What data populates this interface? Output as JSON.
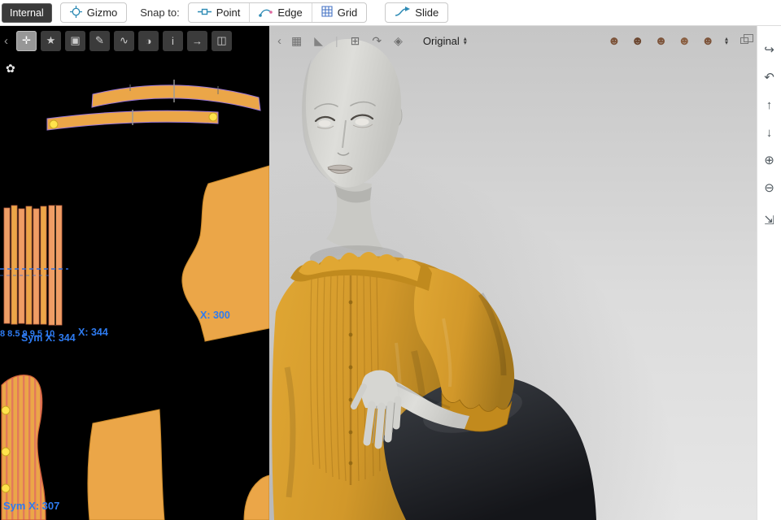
{
  "toolbar": {
    "internal": "Internal",
    "gizmo": "Gizmo",
    "snap_to": "Snap to:",
    "point": "Point",
    "edge": "Edge",
    "grid": "Grid",
    "slide": "Slide"
  },
  "pattern2d": {
    "collapse_glyph": "‹",
    "avatar_toggle_glyph": "✿",
    "tools": [
      {
        "name": "transform-pattern",
        "glyph": "✛",
        "selected": true
      },
      {
        "name": "edit-pattern",
        "glyph": "★",
        "selected": false
      },
      {
        "name": "create-rectangle",
        "glyph": "▣",
        "selected": false
      },
      {
        "name": "create-polygon",
        "glyph": "✎",
        "selected": false
      },
      {
        "name": "edit-curvature",
        "glyph": "∿",
        "selected": false
      },
      {
        "name": "dart-tool",
        "glyph": "◑",
        "selected": false
      },
      {
        "name": "annotation-tool",
        "glyph": "i",
        "selected": false
      },
      {
        "name": "trace-tool",
        "glyph": "→",
        "selected": false
      },
      {
        "name": "seam-tool",
        "glyph": "◫",
        "selected": false
      }
    ],
    "labels": {
      "x_300": "X: 300",
      "grading_sizes": "8 8.5 9 9.5 10",
      "sym_x_344": "Sym X: 344",
      "x_344": "X: 344",
      "sym_x_307": "Sym X: 307"
    },
    "colors": {
      "piece_fill": "#eba648",
      "stripe_red": "#e2795a",
      "outline_purple": "#9a77d8",
      "point_yellow": "#ffe34d",
      "label_blue": "#2e7bf0"
    }
  },
  "view3d": {
    "collapse_glyph": "‹",
    "tools_left": [
      {
        "name": "grid-toggle",
        "glyph": "▦"
      },
      {
        "name": "shade-mode",
        "glyph": "◣"
      },
      {
        "name": "divider",
        "glyph": "|"
      },
      {
        "name": "add-view",
        "glyph": "⊞"
      },
      {
        "name": "reset-rotation",
        "glyph": "↷"
      },
      {
        "name": "snap-view",
        "glyph": "◈"
      }
    ],
    "pose_dropdown": "Original",
    "avatar_display": [
      {
        "name": "show-avatar",
        "glyph": "☻"
      },
      {
        "name": "show-hair",
        "glyph": "☻"
      },
      {
        "name": "show-shoes",
        "glyph": "☻"
      },
      {
        "name": "show-accessories",
        "glyph": "☻"
      },
      {
        "name": "show-motion",
        "glyph": "☻"
      }
    ]
  },
  "side_toolbar": [
    {
      "name": "reset-camera",
      "glyph": "↪"
    },
    {
      "name": "rotate-camera",
      "glyph": "↶"
    },
    {
      "name": "pan-up",
      "glyph": "↑"
    },
    {
      "name": "pan-down",
      "glyph": "↓"
    },
    {
      "name": "zoom-in",
      "glyph": "⊕"
    },
    {
      "name": "zoom-out",
      "glyph": "⊖"
    },
    {
      "name": "fit-view",
      "glyph": "⇲"
    }
  ]
}
